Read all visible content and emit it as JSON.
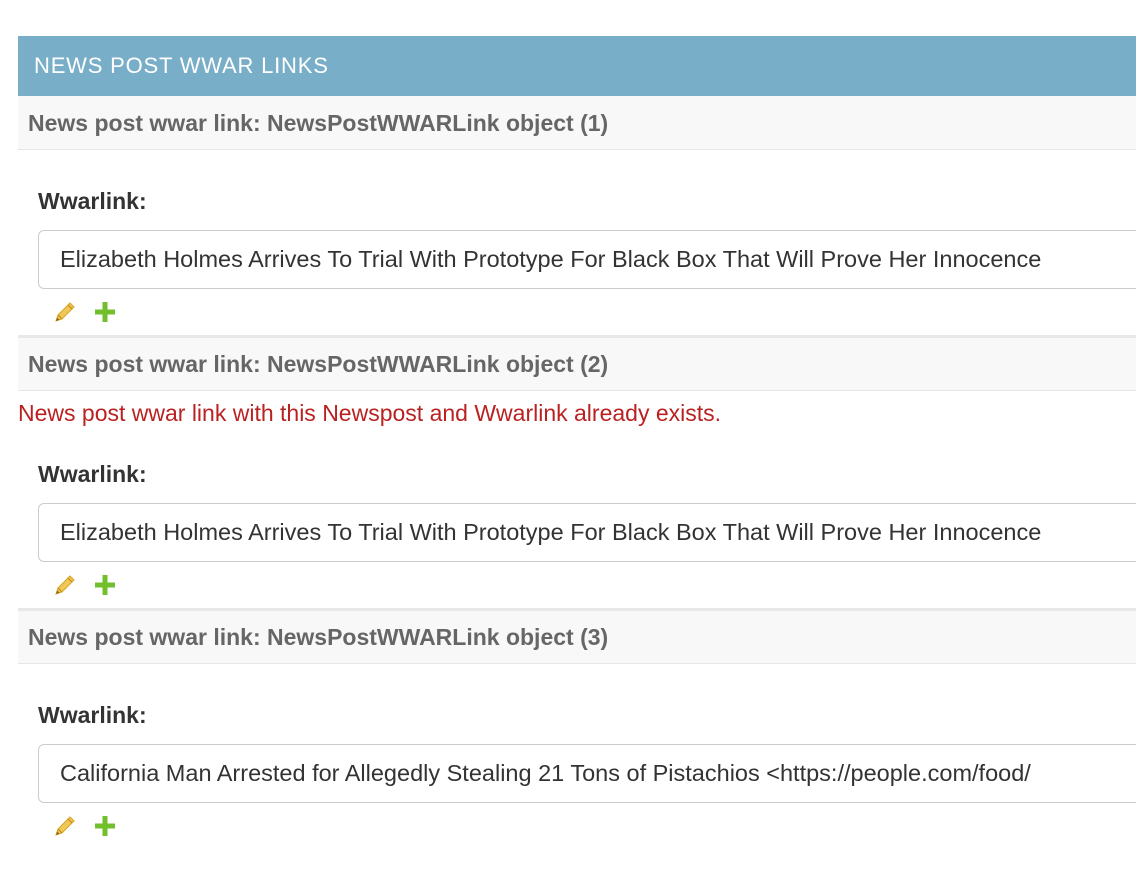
{
  "group": {
    "title": "NEWS POST WWAR LINKS"
  },
  "items": [
    {
      "heading": "News post wwar link: NewsPostWWARLink object (1)",
      "error": "",
      "field_label": "Wwarlink:",
      "selected_value": "Elizabeth Holmes Arrives To Trial With Prototype For Black Box That Will Prove Her Innocence"
    },
    {
      "heading": "News post wwar link: NewsPostWWARLink object (2)",
      "error": "News post wwar link with this Newspost and Wwarlink already exists.",
      "field_label": "Wwarlink:",
      "selected_value": "Elizabeth Holmes Arrives To Trial With Prototype For Black Box That Will Prove Her Innocence"
    },
    {
      "heading": "News post wwar link: NewsPostWWARLink object (3)",
      "error": "",
      "field_label": "Wwarlink:",
      "selected_value": "California Man Arrested for Allegedly Stealing 21 Tons of Pistachios <https://people.com/food/"
    }
  ],
  "icons": {
    "edit": "pencil-icon",
    "add": "plus-icon"
  },
  "colors": {
    "header_bg": "#79aec8",
    "error": "#ba2121",
    "pencil": "#efb80b",
    "plus": "#70bf2b"
  }
}
